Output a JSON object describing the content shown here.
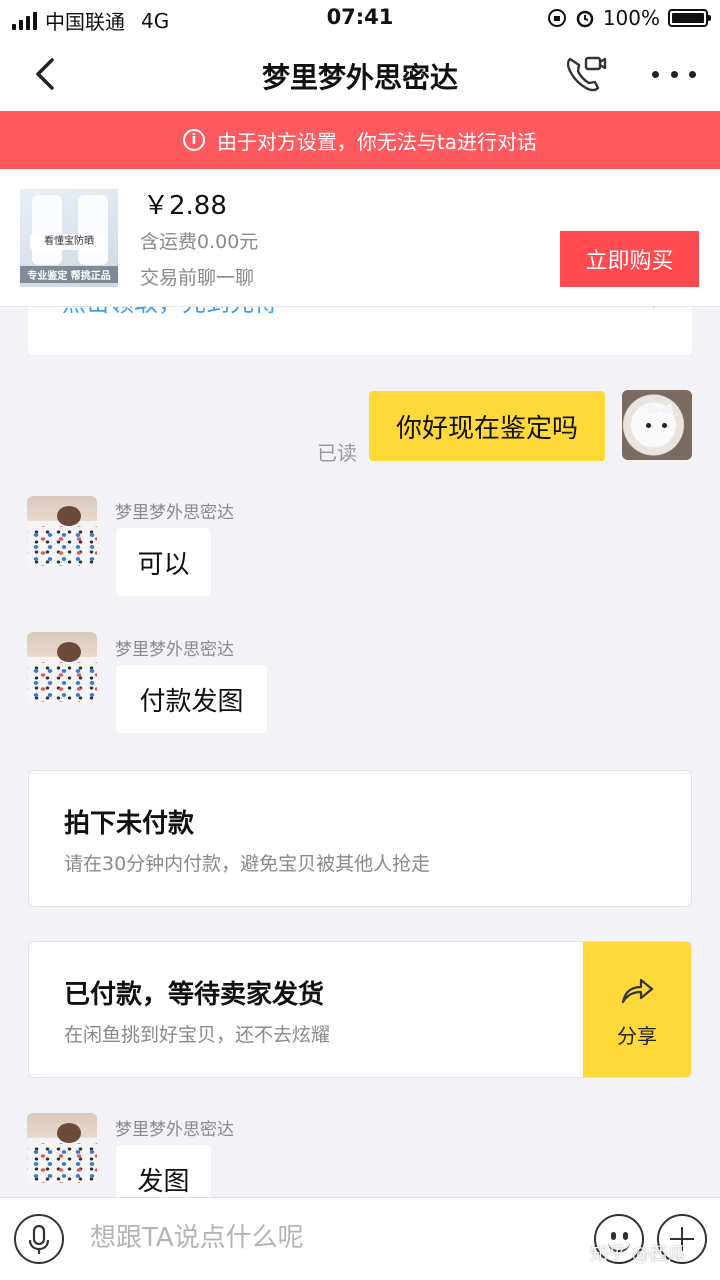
{
  "status_bar": {
    "carrier": "中国联通",
    "network": "4G",
    "time": "07:41",
    "battery": "100%"
  },
  "nav": {
    "title": "梦里梦外思密达"
  },
  "warning": {
    "icon": "info-icon",
    "text": "由于对方设置，你无法与ta进行对话"
  },
  "product": {
    "thumb_label": "专业鉴定 帮挑正品",
    "thumb_band": "看懂宝防晒",
    "price": "￥2.88",
    "shipping": "含运费0.00元",
    "chat_first": "交易前聊一聊",
    "buy_label": "立即购买"
  },
  "coupon": {
    "text": "点击领取，先到先得"
  },
  "messages": {
    "m1": {
      "text": "你好现在鉴定吗",
      "status": "已读"
    },
    "m2": {
      "sender": "梦里梦外思密达",
      "text": "可以"
    },
    "m3": {
      "sender": "梦里梦外思密达",
      "text": "付款发图"
    },
    "m4": {
      "sender": "梦里梦外思密达",
      "text": "发图"
    }
  },
  "order_unpaid": {
    "title": "拍下未付款",
    "subtitle": "请在30分钟内付款，避免宝贝被其他人抢走"
  },
  "order_paid": {
    "title": "已付款，等待卖家发货",
    "subtitle": "在闲鱼挑到好宝贝，还不去炫耀",
    "share_label": "分享",
    "share_icon": "share-arrow-icon"
  },
  "input": {
    "placeholder": "想跟TA说点什么呢"
  },
  "watermark": "知乎 @西瓜",
  "colors": {
    "warning_bg": "#ff5a5f",
    "buy_btn": "#ff4a4f",
    "bubble_out": "#ffd83a",
    "link": "#3aa0e8"
  }
}
